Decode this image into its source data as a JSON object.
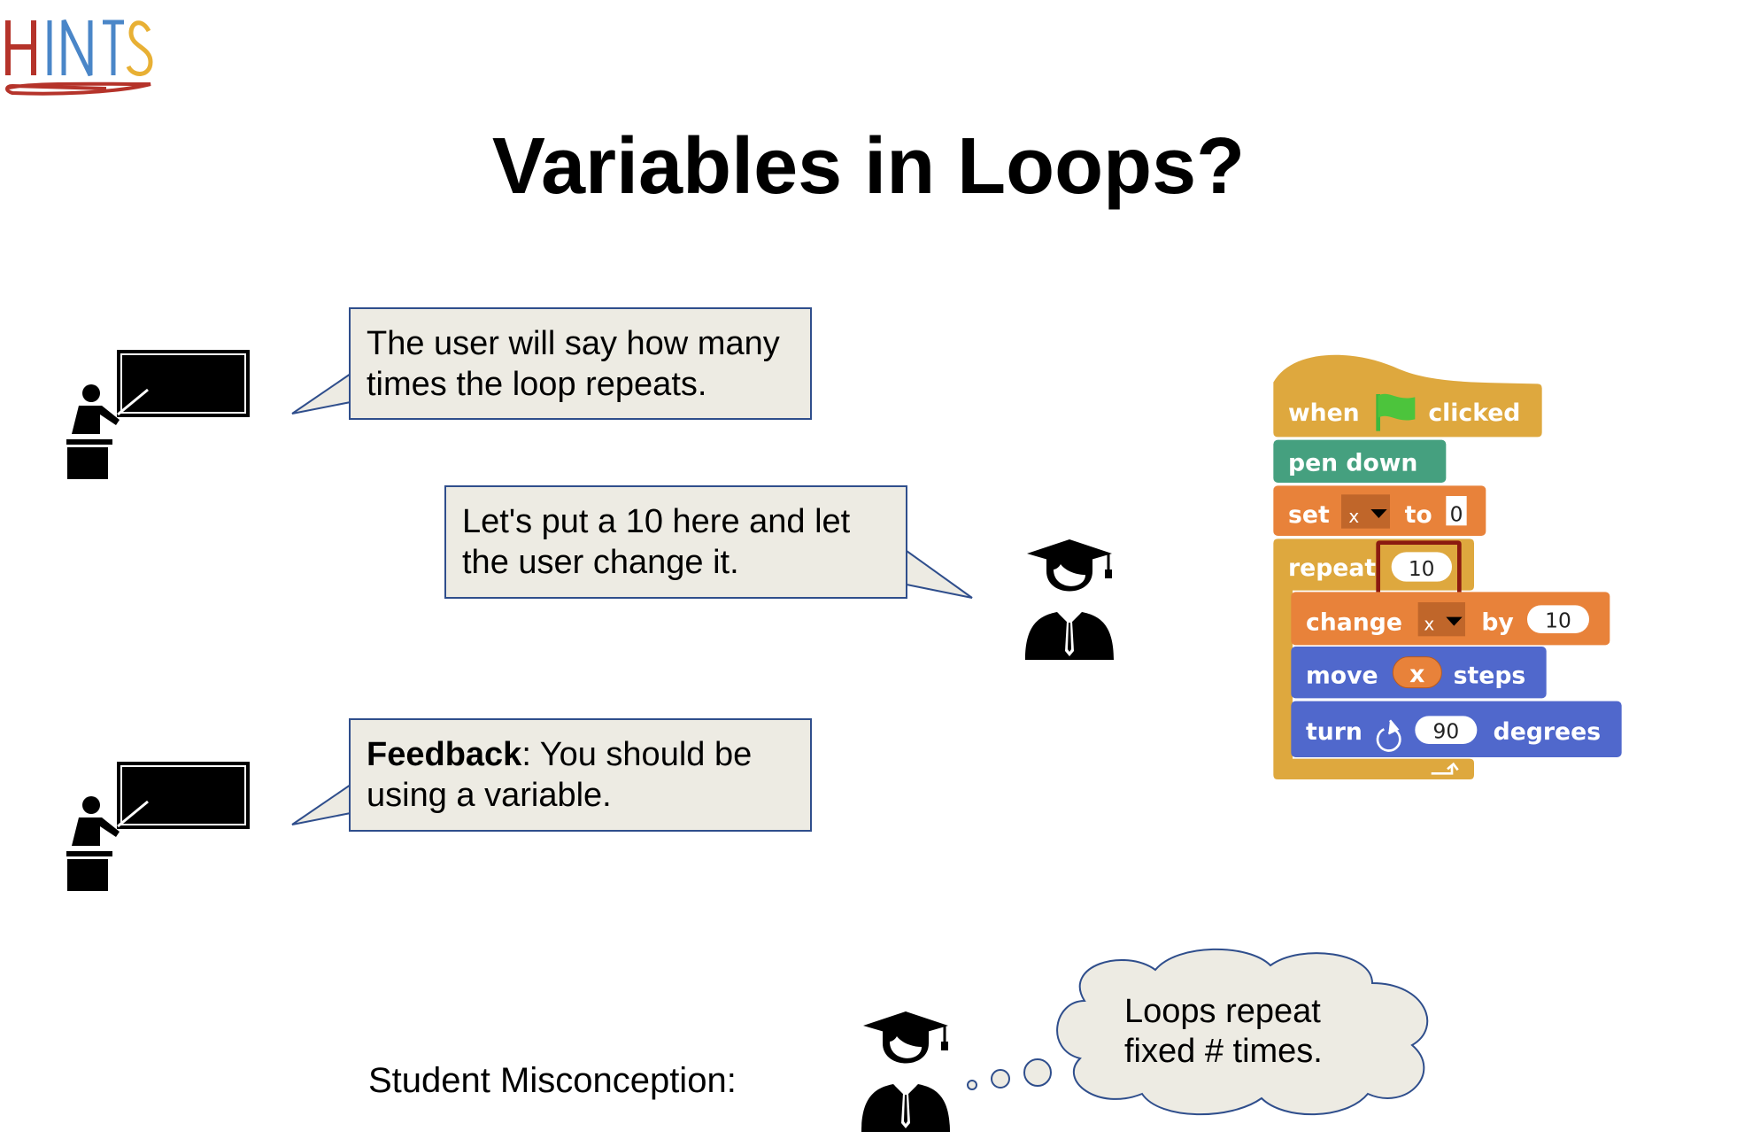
{
  "logo": {
    "text": "HINTS",
    "colors": {
      "H": "#B5332A",
      "INT": "#4A86C8",
      "S": "#E8B034",
      "swoosh": "#B5332A"
    }
  },
  "title": "Variables in Loops?",
  "bubbles": {
    "teacher_1": {
      "lines": [
        "The user will say how many",
        "times the loop repeats."
      ]
    },
    "student_1": {
      "lines": [
        "Let's put a 10 here and let",
        "the user change it."
      ]
    },
    "teacher_2": {
      "bold": "Feedback",
      "rest": ": You should be",
      "line2": "using a variable."
    }
  },
  "misconception": {
    "label": "Student Misconception:",
    "thought_lines": [
      "Loops repeat",
      "fixed # times."
    ]
  },
  "icons": {
    "teacher": "teacher-at-blackboard-icon",
    "student": "graduate-student-icon"
  },
  "script_blocks": {
    "hat": {
      "when": "when",
      "clicked": "clicked"
    },
    "pen_down": "pen down",
    "set": {
      "label": "set",
      "var": "x",
      "to": "to",
      "value": "0"
    },
    "repeat": {
      "label": "repeat",
      "value": "10"
    },
    "change": {
      "label": "change",
      "var": "x",
      "by": "by",
      "value": "10"
    },
    "move": {
      "label": "move",
      "var": "x",
      "steps": "steps"
    },
    "turn": {
      "label": "turn",
      "value": "90",
      "degrees": "degrees"
    },
    "colors": {
      "control": "#DEA83E",
      "pen": "#45A07F",
      "variables": "#E8823A",
      "motion": "#5068CC",
      "highlight": "#8B1A10"
    }
  },
  "colors": {
    "bubble_fill": "#EDEBE3",
    "bubble_border": "#2F4E8C"
  }
}
